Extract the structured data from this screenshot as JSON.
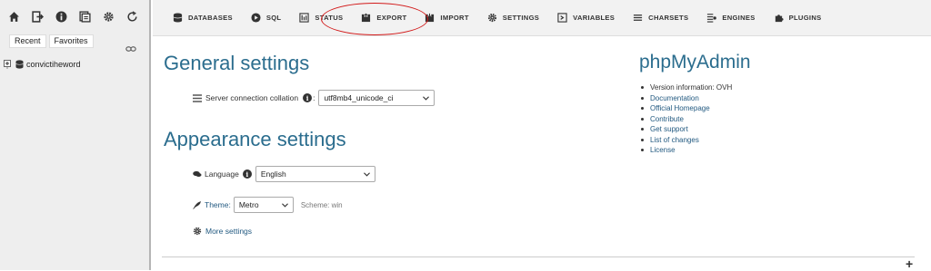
{
  "sidebar": {
    "icons": [
      "home-icon",
      "logout-icon",
      "info-icon",
      "docs-icon",
      "settings-icon",
      "reload-icon"
    ],
    "tabs": [
      {
        "label": "Recent"
      },
      {
        "label": "Favorites"
      }
    ],
    "database": "convictiheword"
  },
  "nav": {
    "items": [
      {
        "label": "Databases",
        "icon": "database-icon"
      },
      {
        "label": "SQL",
        "icon": "sql-icon"
      },
      {
        "label": "Status",
        "icon": "status-icon"
      },
      {
        "label": "Export",
        "icon": "export-icon"
      },
      {
        "label": "Import",
        "icon": "import-icon"
      },
      {
        "label": "Settings",
        "icon": "gear-icon"
      },
      {
        "label": "Variables",
        "icon": "variables-icon"
      },
      {
        "label": "Charsets",
        "icon": "charsets-icon"
      },
      {
        "label": "Engines",
        "icon": "engines-icon"
      },
      {
        "label": "Plugins",
        "icon": "plugins-icon"
      }
    ],
    "annotation_color": "#d21a1a"
  },
  "general": {
    "title": "General settings",
    "collation_label": "Server connection collation",
    "collation_value": "utf8mb4_unicode_ci"
  },
  "appearance": {
    "title": "Appearance settings",
    "language_label": "Language",
    "language_value": "English",
    "theme_label": "Theme:",
    "theme_value": "Metro",
    "scheme_text": "Scheme: win",
    "more_settings": "More settings"
  },
  "pma": {
    "title": "phpMyAdmin",
    "version": "Version information: OVH",
    "links": [
      "Documentation",
      "Official Homepage",
      "Contribute",
      "Get support",
      "List of changes",
      "License"
    ]
  },
  "colors": {
    "heading": "#2b6d8e",
    "link": "#235a81",
    "sidebar_bg": "#eeeeee"
  }
}
